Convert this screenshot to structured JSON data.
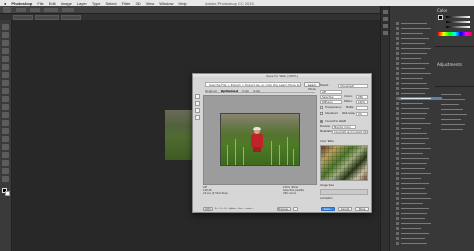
{
  "app": {
    "menu": [
      "Photoshop",
      "File",
      "Edit",
      "Image",
      "Layer",
      "Type",
      "Select",
      "Filter",
      "3D",
      "View",
      "Window",
      "Help"
    ],
    "window_title": "Adobe Photoshop CC 2015"
  },
  "dialog": {
    "title": "Save for Web (100%)",
    "hint": "Use the File > Export > Export As, or click the Learn More button.",
    "learn_more_label": "Learn More",
    "tabs": [
      {
        "label": "Original",
        "active": false
      },
      {
        "label": "Optimized",
        "active": true
      },
      {
        "label": "2-Up",
        "active": false
      },
      {
        "label": "4-Up",
        "active": false
      }
    ],
    "preset": {
      "label": "Preset:",
      "value": "[Unnamed]",
      "format": "GIF",
      "reduction": "Selective",
      "dither_algo": "Diffusion",
      "transparency_label": "Transparency",
      "matte_label": "Matte:",
      "interlaced_label": "Interlaced",
      "colors_label": "Colors:",
      "colors_value": "256",
      "dither_label": "Dither:",
      "dither_value": "100%",
      "web_snap_label": "Web Snap:",
      "web_snap_value": "0%",
      "convert_srgb": "Convert to sRGB",
      "preview_label": "Preview:",
      "preview_value": "Monitor Color",
      "metadata_label": "Metadata:",
      "metadata_value": "Copyright and Contact Info",
      "color_table_label": "Color Table",
      "image_size_label": "Image Size",
      "animation_label": "Animation"
    },
    "stats": {
      "format": "GIF",
      "size": "128.4K",
      "time": "24 sec @ 56.6 Kbps",
      "dither": "100% dither",
      "palette": "Selective palette",
      "colors": "256 colors"
    },
    "zoom": "100%",
    "buttons": {
      "preview": "Preview...",
      "save": "Save...",
      "cancel": "Cancel",
      "done": "Done"
    },
    "readout": "R: --  G: --  B: --  Alpha: --  Hex: --  Index: --"
  },
  "panels": {
    "color_tab": "Color",
    "swatches_tab": "Swatches",
    "adjustments_tab": "Adjustments",
    "layers_tab": "Layers",
    "history_tab": "History"
  },
  "colors": {
    "canvas_bg": "#282828",
    "panel_bg": "#383838",
    "dialog_bg": "#d6d6d6",
    "accent_blue": "#3d86e6",
    "coat_red": "#c0242a"
  }
}
